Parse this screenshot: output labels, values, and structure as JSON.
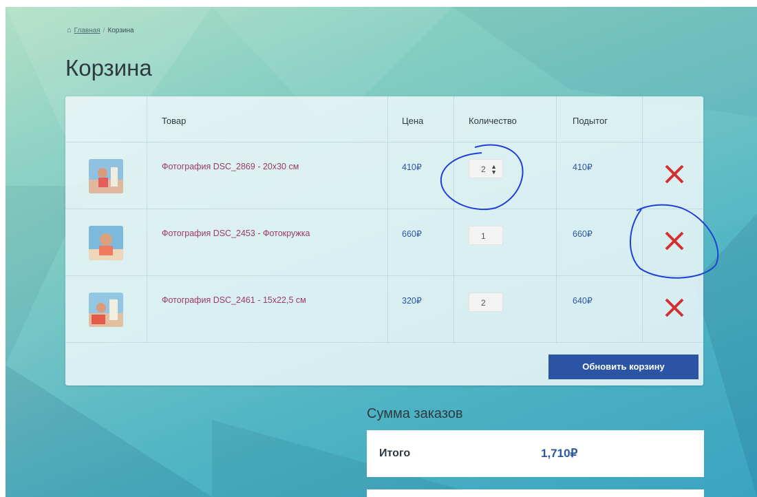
{
  "breadcrumb": {
    "home": "Главная",
    "separator": "/",
    "current": "Корзина"
  },
  "page_title": "Корзина",
  "cart": {
    "headers": {
      "product": "Товар",
      "price": "Цена",
      "quantity": "Количество",
      "subtotal": "Подытог"
    },
    "rows": [
      {
        "name": "Фотография DSC_2869 - 20x30 см",
        "price": "410₽",
        "qty": "2",
        "subtotal": "410₽"
      },
      {
        "name": "Фотография DSC_2453 - Фотокружка",
        "price": "660₽",
        "qty": "1",
        "subtotal": "660₽"
      },
      {
        "name": "Фотография DSC_2461 - 15x22,5 см",
        "price": "320₽",
        "qty": "2",
        "subtotal": "640₽"
      }
    ],
    "update_label": "Обновить корзину"
  },
  "totals": {
    "title": "Сумма заказов",
    "total_label": "Итого",
    "total_value": "1,710₽"
  },
  "icons": {
    "home": "home-icon",
    "remove": "close-icon",
    "spinner": "spinner-arrows-icon"
  },
  "colors": {
    "accent": "#2c54a4",
    "product_link": "#9b3a64",
    "remove": "#d32f2f",
    "annotation": "#1f3fd6"
  }
}
